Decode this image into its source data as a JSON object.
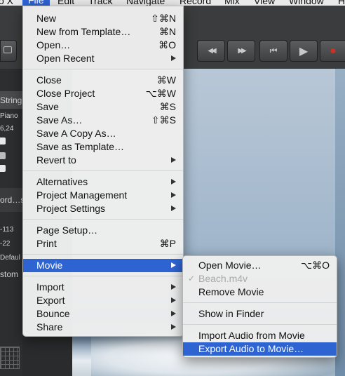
{
  "menubar": {
    "items": [
      {
        "key": "app",
        "label": "o X"
      },
      {
        "key": "file",
        "label": "File"
      },
      {
        "key": "edit",
        "label": "Edit"
      },
      {
        "key": "track",
        "label": "Track"
      },
      {
        "key": "navigate",
        "label": "Navigate"
      },
      {
        "key": "record",
        "label": "Record"
      },
      {
        "key": "mix",
        "label": "Mix"
      },
      {
        "key": "view",
        "label": "View"
      },
      {
        "key": "window",
        "label": "Window"
      },
      {
        "key": "help",
        "label": "H"
      }
    ]
  },
  "transport": {
    "buttons": [
      {
        "name": "rewind-button",
        "glyph": "◀◀"
      },
      {
        "name": "fast-forward-button",
        "glyph": "▶▶"
      },
      {
        "name": "go-to-start-button",
        "glyph": "⏮"
      },
      {
        "name": "play-button",
        "glyph": "▶"
      },
      {
        "name": "record-button",
        "glyph": "●"
      }
    ],
    "record_color": "#d0301f"
  },
  "inspector": {
    "texts": [
      "String",
      "Piano",
      "6,24",
      "ord…s",
      "-113",
      "-22",
      "Defaul",
      "stom"
    ]
  },
  "file_menu": {
    "new": {
      "label": "New",
      "shortcut": "⇧⌘N"
    },
    "new_from_template": {
      "label": "New from Template…",
      "shortcut": "⌘N"
    },
    "open": {
      "label": "Open…",
      "shortcut": "⌘O"
    },
    "open_recent": {
      "label": "Open Recent"
    },
    "close": {
      "label": "Close",
      "shortcut": "⌘W"
    },
    "close_project": {
      "label": "Close Project",
      "shortcut": "⌥⌘W"
    },
    "save": {
      "label": "Save",
      "shortcut": "⌘S"
    },
    "save_as": {
      "label": "Save As…",
      "shortcut": "⇧⌘S"
    },
    "save_copy_as": {
      "label": "Save A Copy As…"
    },
    "save_as_template": {
      "label": "Save as Template…"
    },
    "revert_to": {
      "label": "Revert to"
    },
    "alternatives": {
      "label": "Alternatives"
    },
    "project_management": {
      "label": "Project Management"
    },
    "project_settings": {
      "label": "Project Settings"
    },
    "page_setup": {
      "label": "Page Setup…"
    },
    "print": {
      "label": "Print",
      "shortcut": "⌘P"
    },
    "movie": {
      "label": "Movie"
    },
    "import": {
      "label": "Import"
    },
    "export": {
      "label": "Export"
    },
    "bounce": {
      "label": "Bounce"
    },
    "share": {
      "label": "Share"
    }
  },
  "movie_menu": {
    "open_movie": {
      "label": "Open Movie…",
      "shortcut": "⌥⌘O"
    },
    "current_movie": {
      "label": "Beach.m4v",
      "check": "✓"
    },
    "remove_movie": {
      "label": "Remove Movie"
    },
    "show_in_finder": {
      "label": "Show in Finder"
    },
    "import_audio": {
      "label": "Import Audio from Movie"
    },
    "export_audio": {
      "label": "Export Audio to Movie…"
    }
  },
  "colors": {
    "highlight": "#2e63d2"
  }
}
